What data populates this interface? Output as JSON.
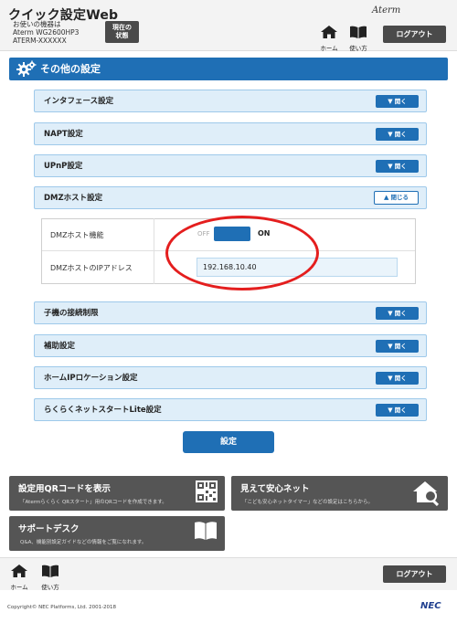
{
  "header": {
    "app_title": "クイック設定Web",
    "model_line1": "お使いの機器は",
    "model_line2": "Aterm WG2600HP3",
    "model_line3": "ATERM-XXXXXX",
    "status_button_line1": "現在の",
    "status_button_line2": "状態",
    "brand": "Aterm",
    "home_label": "ホーム",
    "howto_label": "使い方",
    "logout_label": "ログアウト"
  },
  "section_title": "その他の設定",
  "accordions": [
    {
      "label": "インタフェース設定",
      "button": "開く"
    },
    {
      "label": "NAPT設定",
      "button": "開く"
    },
    {
      "label": "UPnP設定",
      "button": "開く"
    },
    {
      "label": "DMZホスト設定",
      "button": "閉じる"
    },
    {
      "label": "子機の接続制限",
      "button": "開く"
    },
    {
      "label": "補助設定",
      "button": "開く"
    },
    {
      "label": "ホームIPロケーション設定",
      "button": "開く"
    },
    {
      "label": "らくらくネットスタートLite設定",
      "button": "開く"
    }
  ],
  "dmz": {
    "function_label": "DMZホスト機能",
    "toggle_off": "OFF",
    "toggle_on": "ON",
    "toggle_state": "ON",
    "ip_label": "DMZホストのIPアドレス",
    "ip_value": "192.168.10.40"
  },
  "submit_label": "設定",
  "panels": {
    "qr_title": "設定用QRコードを表示",
    "qr_desc": "「Atermらくらく QRスタート」用のQRコードを作成できます。",
    "safety_title": "見えて安心ネット",
    "safety_desc": "「こども安心ネットタイマー」などの設定はこちらから。",
    "support_title": "サポートデスク",
    "support_desc": "Q&A、機能別設定ガイドなどの情報をご覧になれます。"
  },
  "footer": {
    "home_label": "ホーム",
    "howto_label": "使い方",
    "logout_label": "ログアウト",
    "copyright": "Copyright© NEC Platforms, Ltd. 2001-2018",
    "nec": "NEC"
  },
  "colors": {
    "accent_blue": "#1f6fb5",
    "accordion_bg": "#dfeef9",
    "dark_button": "#4a4a4a",
    "highlight_red": "#e41e1e"
  }
}
